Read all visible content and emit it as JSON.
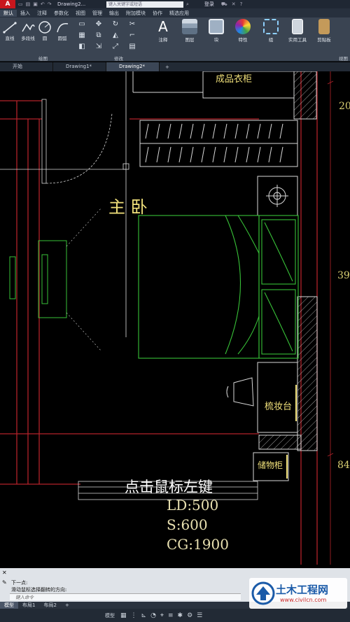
{
  "titlebar": {
    "app_logo": "A",
    "doc_title": "Drawing2...",
    "search_placeholder": "键入关键字或短语",
    "login_label": "登录",
    "quick_access_icons": [
      "new-icon",
      "open-icon",
      "save-icon",
      "undo-icon",
      "redo-icon"
    ]
  },
  "ribbon_tabs": [
    "默认",
    "插入",
    "注释",
    "参数化",
    "视图",
    "管理",
    "输出",
    "附加模块",
    "协作",
    "精选应用"
  ],
  "ribbon": {
    "draw_tools": [
      {
        "label": "直线",
        "icon": "line-icon"
      },
      {
        "label": "多段线",
        "icon": "polyline-icon"
      },
      {
        "label": "圆",
        "icon": "circle-icon"
      },
      {
        "label": "圆弧",
        "icon": "arc-icon"
      }
    ],
    "draw_panel_label": "绘图",
    "modify_panel_label": "修改",
    "big_tools": [
      {
        "label": "注释",
        "icon": "annotation-icon"
      },
      {
        "label": "图层",
        "icon": "layers-icon"
      },
      {
        "label": "块",
        "icon": "block-icon"
      },
      {
        "label": "特性",
        "icon": "properties-icon"
      },
      {
        "label": "组",
        "icon": "group-icon"
      },
      {
        "label": "实用工具",
        "icon": "utilities-icon"
      },
      {
        "label": "剪贴板",
        "icon": "clipboard-icon"
      }
    ],
    "view_label": "视图"
  },
  "doc_tabs": [
    {
      "label": "开始"
    },
    {
      "label": "Drawing1*"
    },
    {
      "label": "Drawing2*"
    }
  ],
  "drawing": {
    "labels": {
      "wardrobe": "成品衣柜",
      "master_bedroom": "主 卧",
      "dresser": "梳妆台",
      "storage": "储物柜"
    },
    "dimensions": {
      "right_top": "20",
      "right_mid": "39",
      "right_low": "84"
    },
    "overlay": {
      "instruction": "点击鼠标左键",
      "ld": "LD:500",
      "s": "S:600",
      "cg": "CG:1900"
    }
  },
  "command": {
    "line1": "下一点:",
    "line2": "滑动鼠标选择翻转的方向:",
    "input_placeholder": "键入命令"
  },
  "layout_tabs": [
    "模型",
    "布局1",
    "布局2"
  ],
  "status": {
    "model_label": "模型"
  },
  "watermark": {
    "text": "土木工程网",
    "url": "www.civilcn.com"
  },
  "colors": {
    "canvas": "#000000",
    "wall_red": "#b3222a",
    "furniture_white": "#d8d8d8",
    "bed_green": "#38c238",
    "label_yellow": "#f0e07a",
    "ribbon": "#3a4452"
  }
}
